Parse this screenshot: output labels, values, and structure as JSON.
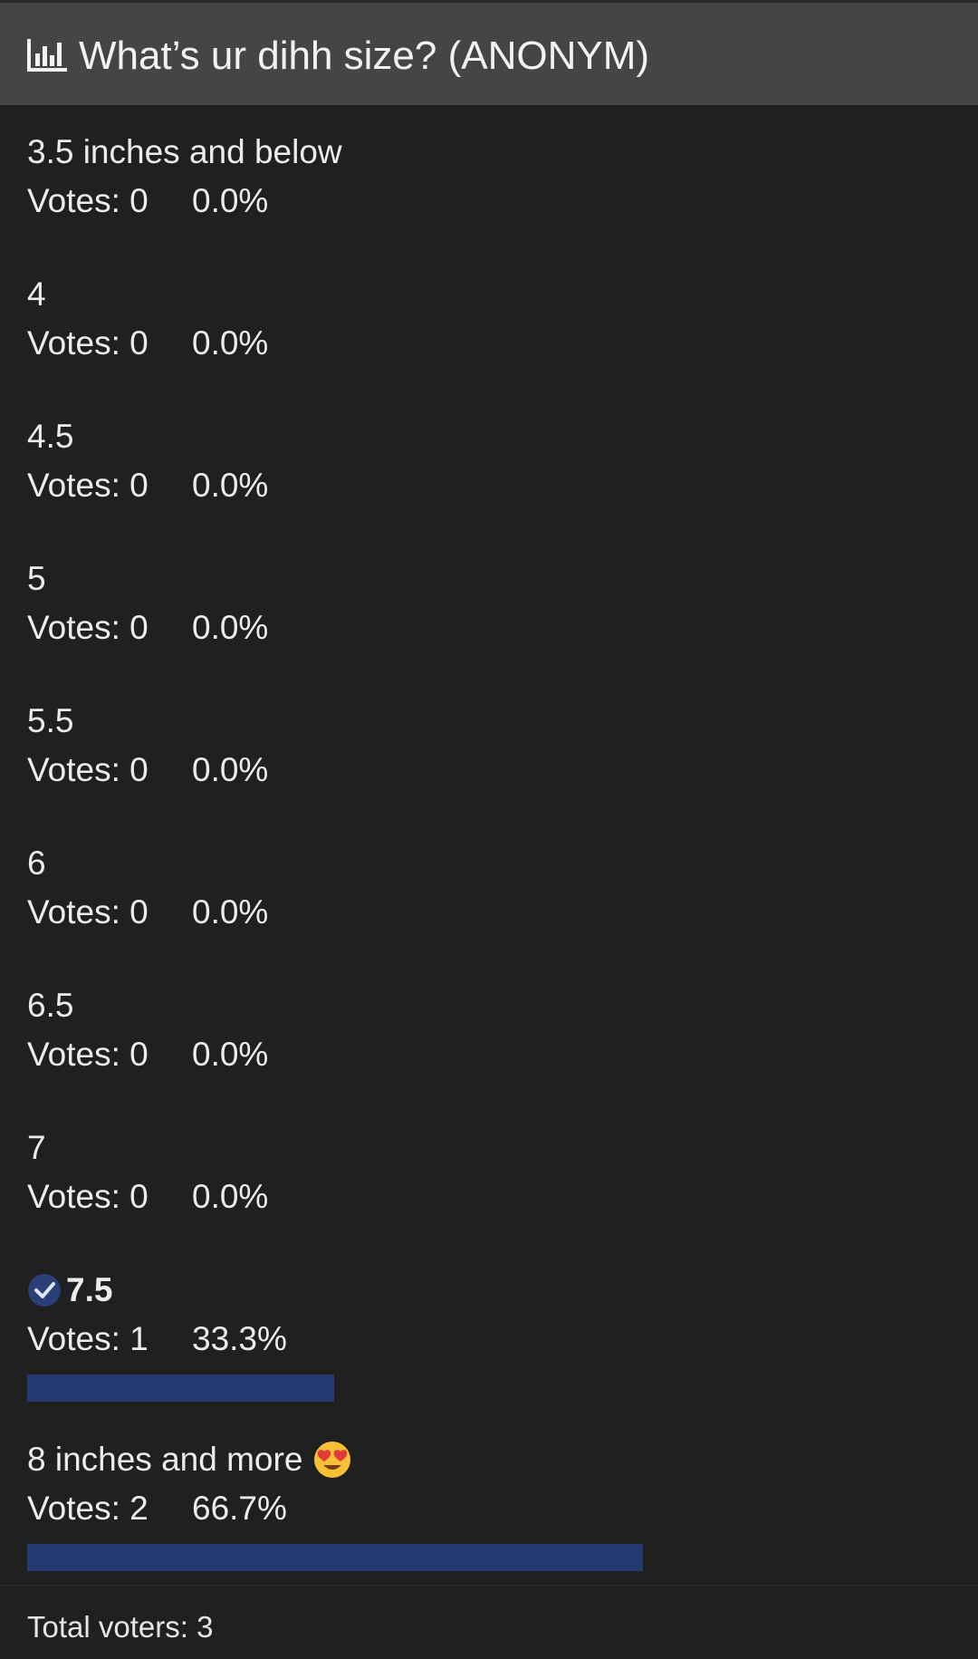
{
  "poll": {
    "icon": "poll-chart-icon",
    "title": "What’s ur dihh size? (ANONYM)",
    "options": [
      {
        "label": "3.5 inches and below",
        "votes_text": "Votes: 0",
        "percent_text": "0.0%",
        "fraction": 0.0,
        "voted": false
      },
      {
        "label": "4",
        "votes_text": "Votes: 0",
        "percent_text": "0.0%",
        "fraction": 0.0,
        "voted": false
      },
      {
        "label": "4.5",
        "votes_text": "Votes: 0",
        "percent_text": "0.0%",
        "fraction": 0.0,
        "voted": false
      },
      {
        "label": "5",
        "votes_text": "Votes: 0",
        "percent_text": "0.0%",
        "fraction": 0.0,
        "voted": false
      },
      {
        "label": "5.5",
        "votes_text": "Votes: 0",
        "percent_text": "0.0%",
        "fraction": 0.0,
        "voted": false
      },
      {
        "label": "6",
        "votes_text": "Votes: 0",
        "percent_text": "0.0%",
        "fraction": 0.0,
        "voted": false
      },
      {
        "label": "6.5",
        "votes_text": "Votes: 0",
        "percent_text": "0.0%",
        "fraction": 0.0,
        "voted": false
      },
      {
        "label": "7",
        "votes_text": "Votes: 0",
        "percent_text": "0.0%",
        "fraction": 0.0,
        "voted": false
      },
      {
        "label": "7.5",
        "votes_text": "Votes: 1",
        "percent_text": "33.3%",
        "fraction": 0.333,
        "voted": true,
        "icon": "check-circle-icon"
      },
      {
        "label": "8 inches and more",
        "votes_text": "Votes: 2",
        "percent_text": "66.7%",
        "fraction": 0.667,
        "voted": false,
        "emoji": "heart-eyes-emoji-icon"
      }
    ],
    "total_text": "Total voters: 3"
  },
  "colors": {
    "background": "#202020",
    "header": "#454545",
    "bar": "#263a72",
    "check": "#2a3f78"
  }
}
